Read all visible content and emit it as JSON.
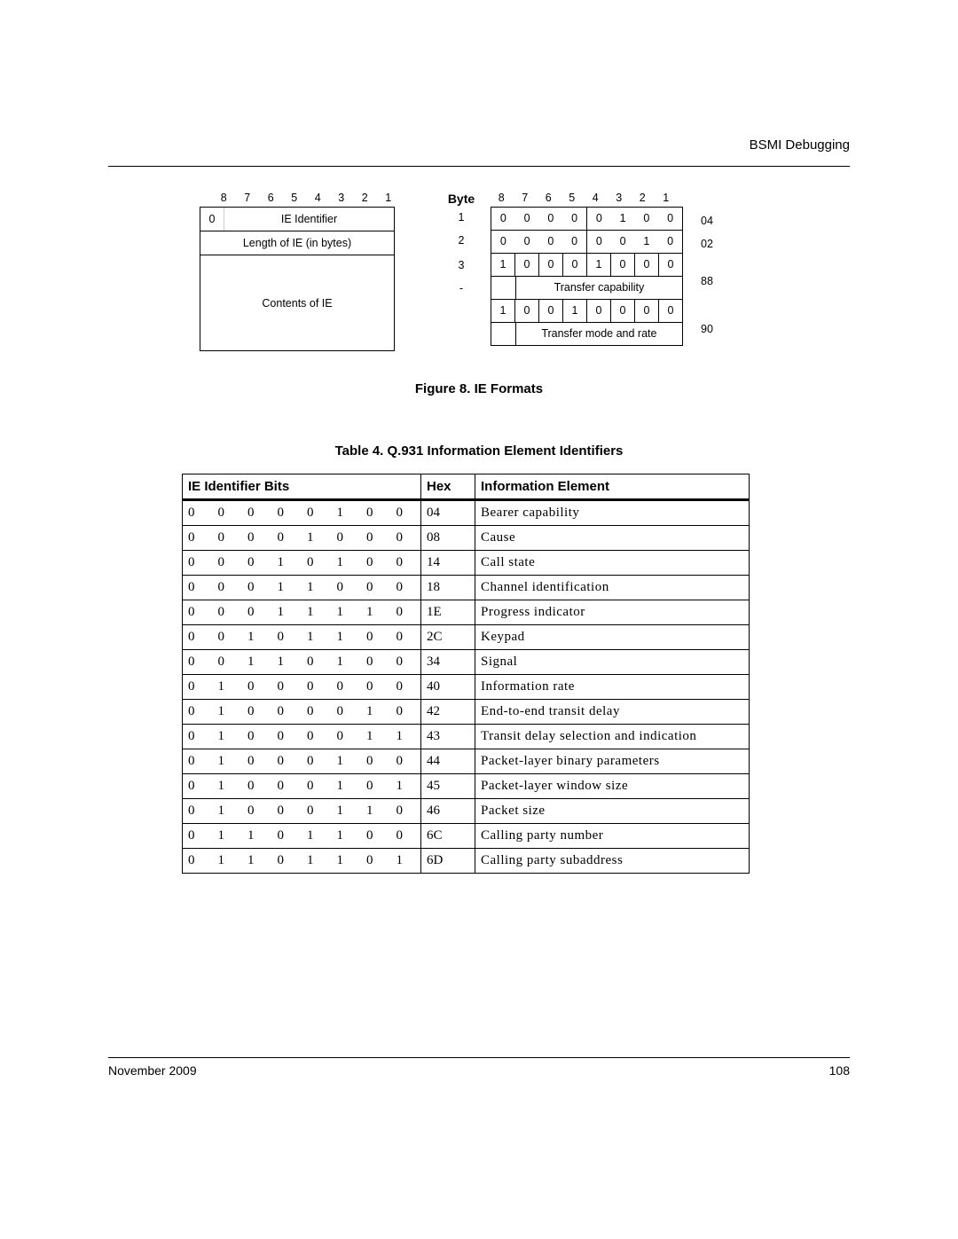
{
  "header": {
    "section": "BSMI Debugging"
  },
  "figure": {
    "bit_labels": [
      "8",
      "7",
      "6",
      "5",
      "4",
      "3",
      "2",
      "1"
    ],
    "byte_word": "Byte",
    "left": {
      "first_zero": "0",
      "row1": "IE Identifier",
      "row2": "Length of IE (in bytes)",
      "row3": "Contents of IE"
    },
    "center": [
      "1",
      "2",
      "3",
      "-"
    ],
    "right_rows": [
      [
        "0",
        "0",
        "0",
        "0",
        "0",
        "1",
        "0",
        "0"
      ],
      [
        "0",
        "0",
        "0",
        "0",
        "0",
        "0",
        "1",
        "0"
      ],
      [
        "1",
        "0",
        "0",
        "0",
        "1",
        "0",
        "0",
        "0"
      ],
      [
        "1",
        "0",
        "0",
        "1",
        "0",
        "0",
        "0",
        "0"
      ]
    ],
    "right_sub1": "Transfer capability",
    "right_sub2": "Transfer mode and rate",
    "hex": [
      "04",
      "02",
      "88",
      "90"
    ],
    "caption": "Figure 8.   IE Formats"
  },
  "table": {
    "caption": "Table 4.   Q.931 Information Element Identifiers",
    "headers": {
      "bits": "IE Identifier Bits",
      "hex": "Hex",
      "name": "Information Element"
    },
    "rows": [
      {
        "bits": [
          "0",
          "0",
          "0",
          "0",
          "0",
          "1",
          "0",
          "0"
        ],
        "hex": "04",
        "name": "Bearer capability"
      },
      {
        "bits": [
          "0",
          "0",
          "0",
          "0",
          "1",
          "0",
          "0",
          "0"
        ],
        "hex": "08",
        "name": "Cause"
      },
      {
        "bits": [
          "0",
          "0",
          "0",
          "1",
          "0",
          "1",
          "0",
          "0"
        ],
        "hex": "14",
        "name": "Call state"
      },
      {
        "bits": [
          "0",
          "0",
          "0",
          "1",
          "1",
          "0",
          "0",
          "0"
        ],
        "hex": "18",
        "name": "Channel identification"
      },
      {
        "bits": [
          "0",
          "0",
          "0",
          "1",
          "1",
          "1",
          "1",
          "0"
        ],
        "hex": "1E",
        "name": "Progress indicator"
      },
      {
        "bits": [
          "0",
          "0",
          "1",
          "0",
          "1",
          "1",
          "0",
          "0"
        ],
        "hex": "2C",
        "name": "Keypad"
      },
      {
        "bits": [
          "0",
          "0",
          "1",
          "1",
          "0",
          "1",
          "0",
          "0"
        ],
        "hex": "34",
        "name": "Signal"
      },
      {
        "bits": [
          "0",
          "1",
          "0",
          "0",
          "0",
          "0",
          "0",
          "0"
        ],
        "hex": "40",
        "name": "Information rate"
      },
      {
        "bits": [
          "0",
          "1",
          "0",
          "0",
          "0",
          "0",
          "1",
          "0"
        ],
        "hex": "42",
        "name": "End-to-end transit delay"
      },
      {
        "bits": [
          "0",
          "1",
          "0",
          "0",
          "0",
          "0",
          "1",
          "1"
        ],
        "hex": "43",
        "name": "Transit delay selection and indication"
      },
      {
        "bits": [
          "0",
          "1",
          "0",
          "0",
          "0",
          "1",
          "0",
          "0"
        ],
        "hex": "44",
        "name": "Packet-layer binary parameters"
      },
      {
        "bits": [
          "0",
          "1",
          "0",
          "0",
          "0",
          "1",
          "0",
          "1"
        ],
        "hex": "45",
        "name": "Packet-layer window size"
      },
      {
        "bits": [
          "0",
          "1",
          "0",
          "0",
          "0",
          "1",
          "1",
          "0"
        ],
        "hex": "46",
        "name": "Packet size"
      },
      {
        "bits": [
          "0",
          "1",
          "1",
          "0",
          "1",
          "1",
          "0",
          "0"
        ],
        "hex": "6C",
        "name": "Calling party number"
      },
      {
        "bits": [
          "0",
          "1",
          "1",
          "0",
          "1",
          "1",
          "0",
          "1"
        ],
        "hex": "6D",
        "name": "Calling party subaddress"
      }
    ]
  },
  "footer": {
    "date": "November 2009",
    "page": "108"
  }
}
